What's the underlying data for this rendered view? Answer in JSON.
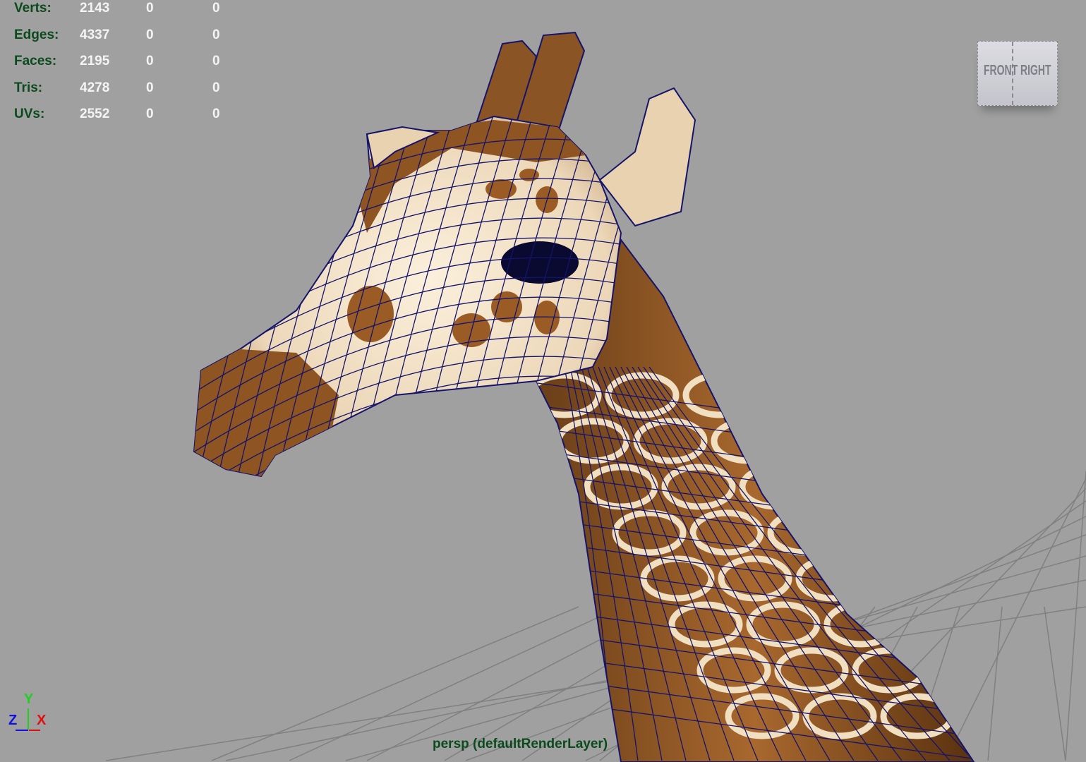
{
  "heads_up_display": {
    "rows": [
      {
        "label": "Verts:",
        "values": [
          "2143",
          "0",
          "0"
        ]
      },
      {
        "label": "Edges:",
        "values": [
          "4337",
          "0",
          "0"
        ]
      },
      {
        "label": "Faces:",
        "values": [
          "2195",
          "0",
          "0"
        ]
      },
      {
        "label": "Tris:",
        "values": [
          "4278",
          "0",
          "0"
        ]
      },
      {
        "label": "UVs:",
        "values": [
          "2552",
          "0",
          "0"
        ]
      }
    ]
  },
  "view_cube": {
    "front": "FRONT",
    "right": "RIGHT"
  },
  "axis_gizmo": {
    "x": "X",
    "y": "Y",
    "z": "Z",
    "x_color": "#e01010",
    "y_color": "#20d020",
    "z_color": "#1010e0"
  },
  "camera_label": "persp (defaultRenderLayer)",
  "colors": {
    "background": "#a0a0a0",
    "wireframe": "#14146a",
    "hud_label": "#0b4a1c"
  }
}
